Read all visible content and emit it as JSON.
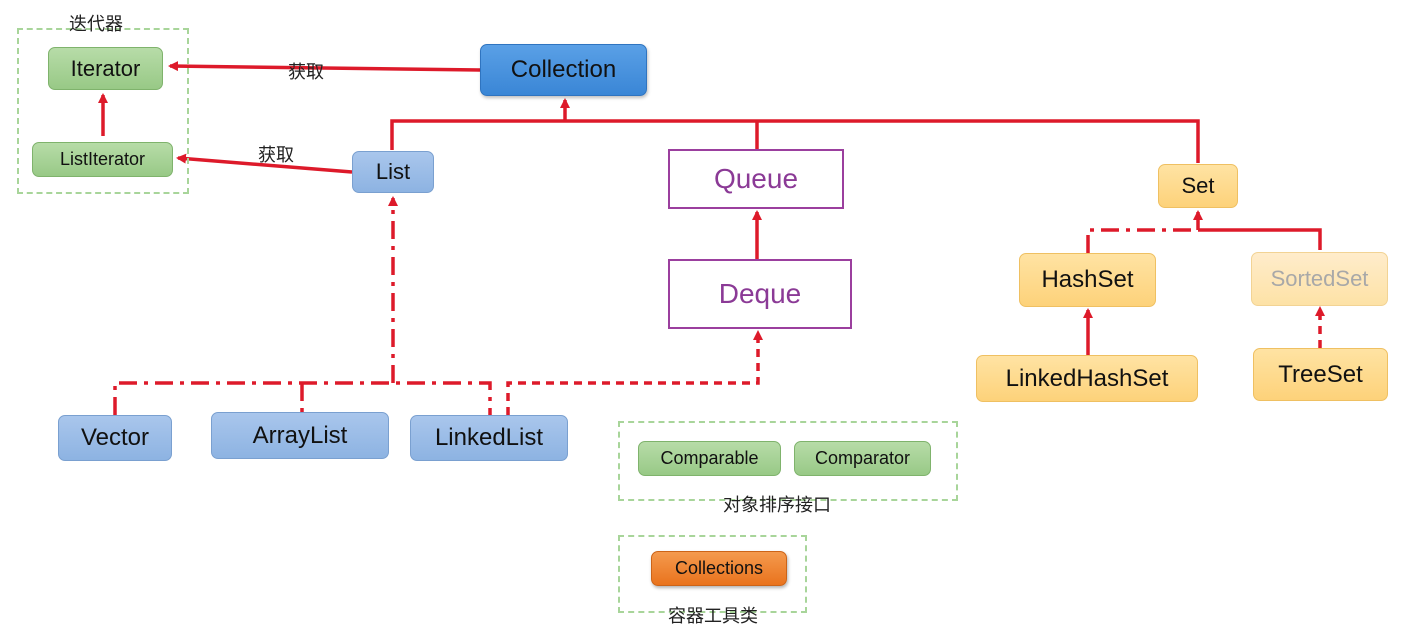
{
  "groups": {
    "iterator_group": "迭代器",
    "comparator_group": "对象排序接口",
    "tools_group": "容器工具类"
  },
  "edge_labels": {
    "collection_to_iterator": "获取",
    "list_to_listiterator": "获取"
  },
  "nodes": {
    "iterator": "Iterator",
    "list_iterator": "ListIterator",
    "collection": "Collection",
    "list": "List",
    "queue": "Queue",
    "deque": "Deque",
    "set": "Set",
    "hash_set": "HashSet",
    "sorted_set": "SortedSet",
    "linked_hash_set": "LinkedHashSet",
    "tree_set": "TreeSet",
    "vector": "Vector",
    "array_list": "ArrayList",
    "linked_list": "LinkedList",
    "comparable": "Comparable",
    "comparator": "Comparator",
    "collections": "Collections"
  },
  "colors": {
    "edge": "#dd1a2a",
    "interface_green": "#98c986",
    "class_blue": "#8db3e2",
    "collection_blue": "#3a86d6",
    "set_yellow": "#fdd27a",
    "queue_purple": "#9b3f9e",
    "tools_orange": "#e9731d"
  }
}
